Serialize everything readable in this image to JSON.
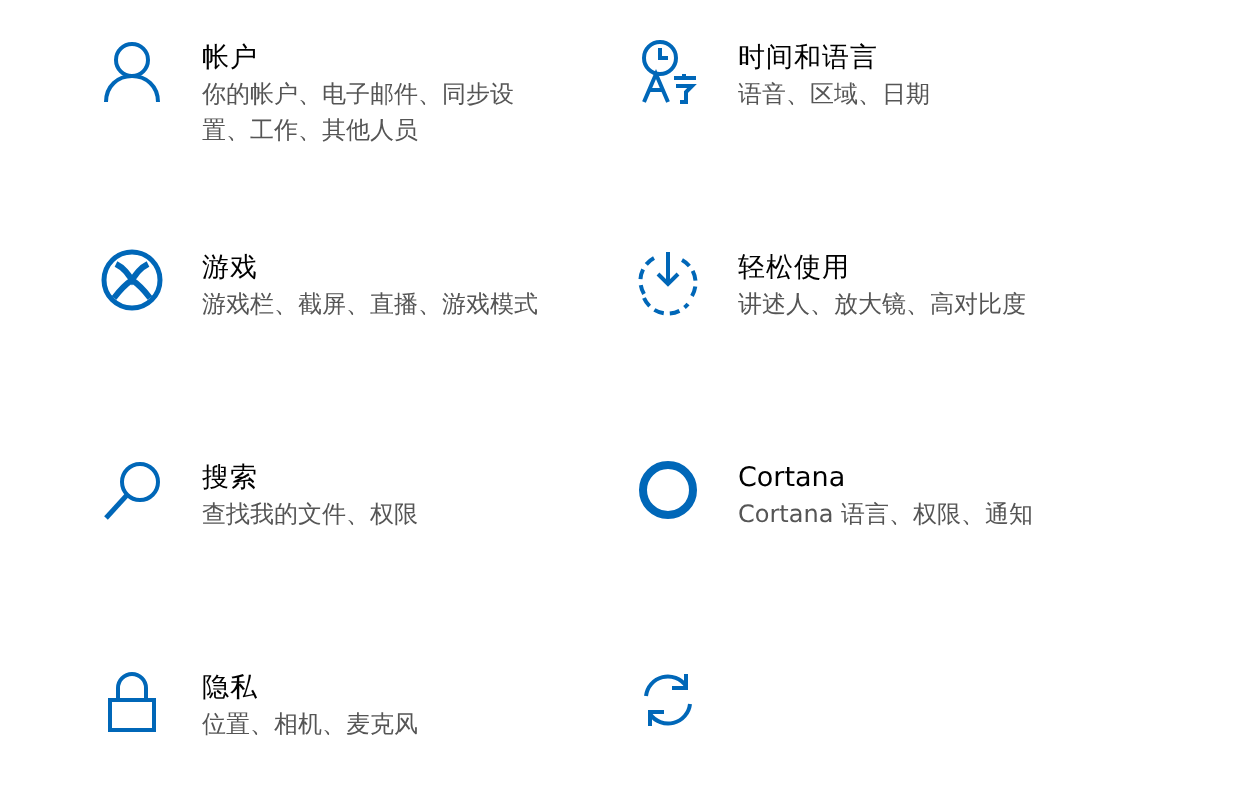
{
  "items": [
    {
      "kind": "account",
      "title": "帐户",
      "subtitle": "你的帐户、电子邮件、同步设置、工作、其他人员"
    },
    {
      "kind": "time-language",
      "title": "时间和语言",
      "subtitle": "语音、区域、日期"
    },
    {
      "kind": "gaming",
      "title": "游戏",
      "subtitle": "游戏栏、截屏、直播、游戏模式"
    },
    {
      "kind": "ease-of-access",
      "title": "轻松使用",
      "subtitle": "讲述人、放大镜、高对比度"
    },
    {
      "kind": "search",
      "title": "搜索",
      "subtitle": "查找我的文件、权限"
    },
    {
      "kind": "cortana",
      "title": "Cortana",
      "subtitle": "Cortana 语言、权限、通知"
    },
    {
      "kind": "privacy",
      "title": "隐私",
      "subtitle": "位置、相机、麦克风"
    },
    {
      "kind": "update"
    }
  ]
}
